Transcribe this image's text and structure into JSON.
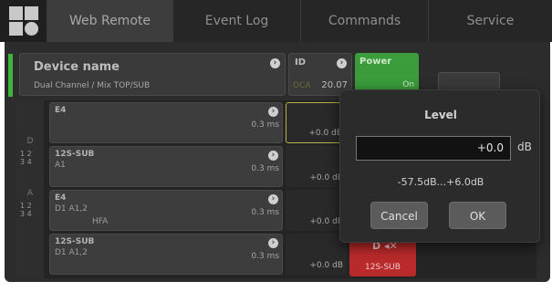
{
  "tabs": [
    "Web Remote",
    "Event Log",
    "Commands",
    "Service"
  ],
  "device": {
    "name": "Device name",
    "type": "Dual Channel / Mix TOP/SUB",
    "id_label": "ID",
    "oca_label": "OCA",
    "id_value": "20.07",
    "power_label": "Power",
    "power_state": "On"
  },
  "side": {
    "d_label": "D",
    "a_label": "A",
    "nums": [
      "1 2",
      "3 4"
    ]
  },
  "rows": [
    {
      "name": "E4",
      "sub": "",
      "hfa": "",
      "delay": "0.3 ms",
      "gain": "+0.0 dB"
    },
    {
      "name": "12S-SUB",
      "sub": "A1",
      "hfa": "",
      "delay": "0.3 ms",
      "gain": "+0.0 dB"
    },
    {
      "name": "E4",
      "sub": "D1 A1,2",
      "hfa": "HFA",
      "delay": "0.3 ms",
      "gain": "+0.0 dB"
    },
    {
      "name": "12S-SUB",
      "sub": "D1 A1,2",
      "hfa": "",
      "delay": "0.3 ms",
      "gain": "+0.0 dB"
    }
  ],
  "mute": {
    "label": "D",
    "name": "12S-SUB"
  },
  "dialog": {
    "title": "Level",
    "value": "+0.0",
    "unit": "dB",
    "range": "-57.5dB...+6.0dB",
    "cancel": "Cancel",
    "ok": "OK"
  },
  "colors": {
    "power": "#3a9c3a",
    "mute": "#b92a2a",
    "status": "#3fb33b"
  }
}
